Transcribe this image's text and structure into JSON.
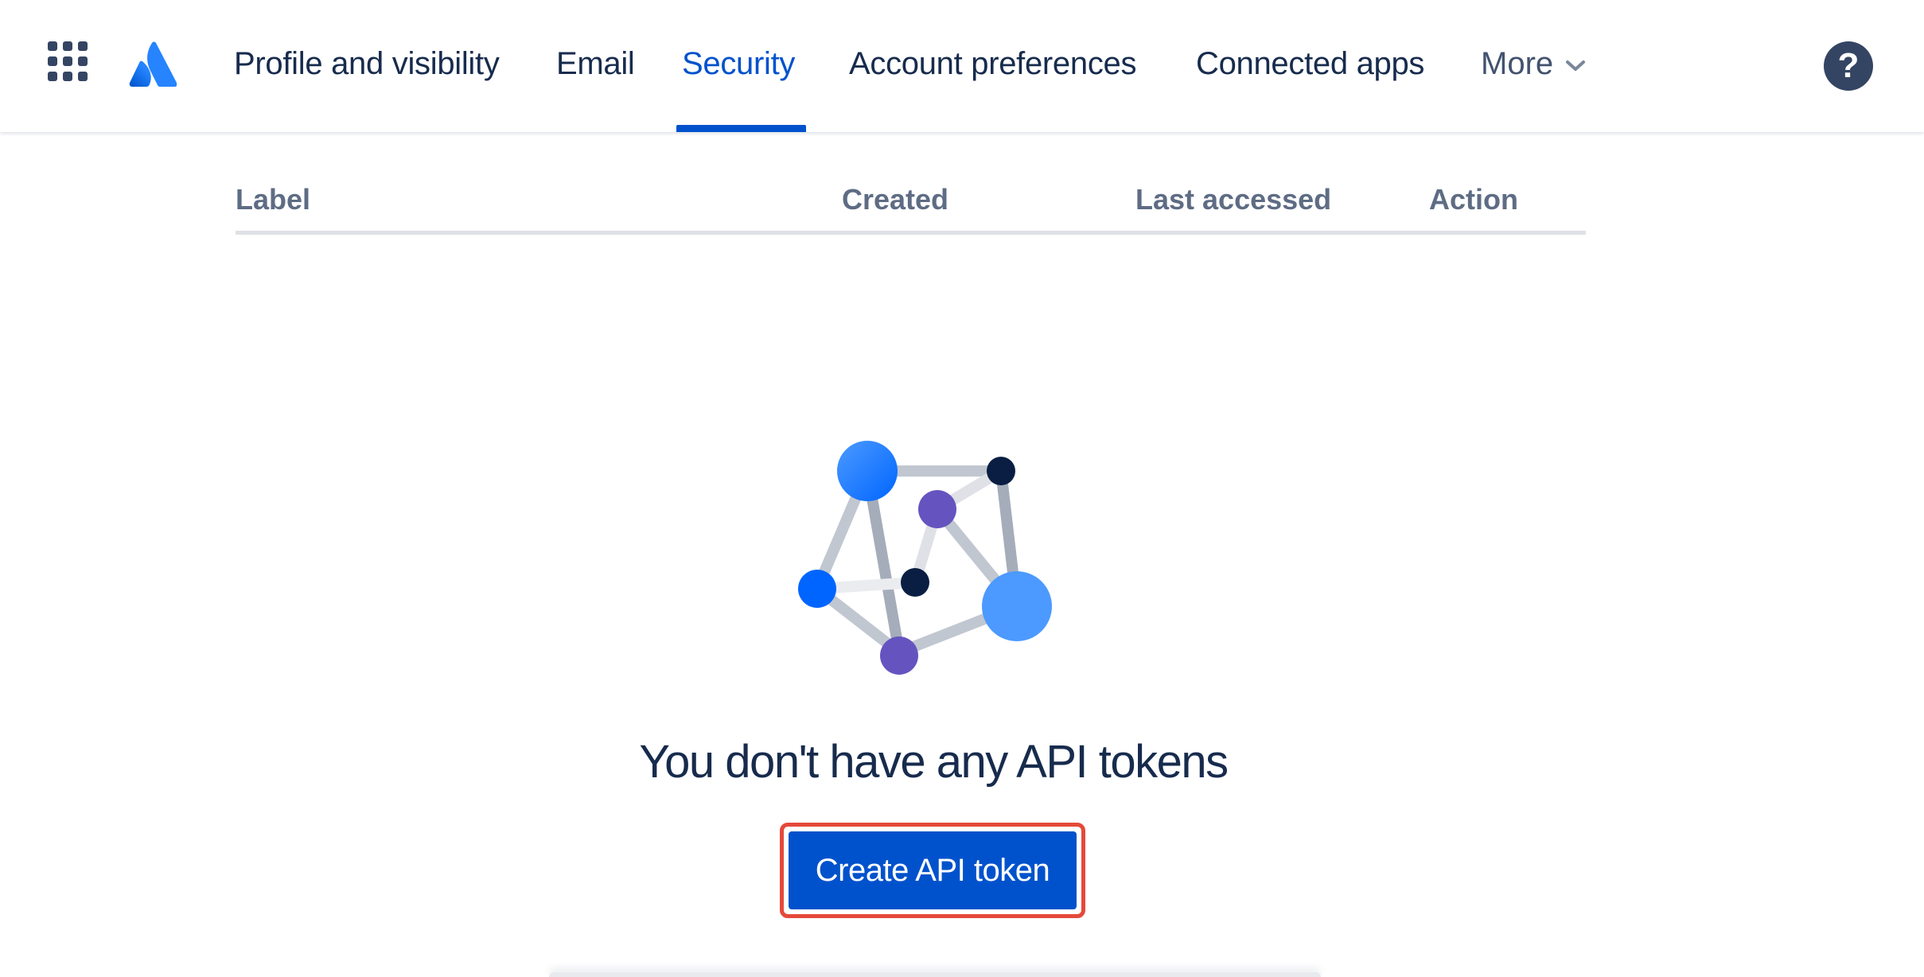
{
  "nav": {
    "items": [
      {
        "label": "Profile and visibility"
      },
      {
        "label": "Email"
      },
      {
        "label": "Security"
      },
      {
        "label": "Account preferences"
      },
      {
        "label": "Connected apps"
      }
    ],
    "active": "Security",
    "more_label": "More",
    "help_glyph": "?"
  },
  "table": {
    "headers": [
      "Label",
      "Created",
      "Last accessed",
      "Action"
    ]
  },
  "empty_state": {
    "title": "You don't have any API tokens",
    "button_label": "Create API token"
  },
  "colors": {
    "accent": "#0052cc",
    "highlight_border": "#e5493a",
    "text": "#172b4d",
    "header_text": "#5e6c84"
  },
  "icons": {
    "app_switcher": "grid-icon",
    "logo": "atlassian-logo-icon",
    "more_chevron": "chevron-down-icon",
    "help": "help-icon",
    "illustration": "api-token-network-illustration"
  }
}
